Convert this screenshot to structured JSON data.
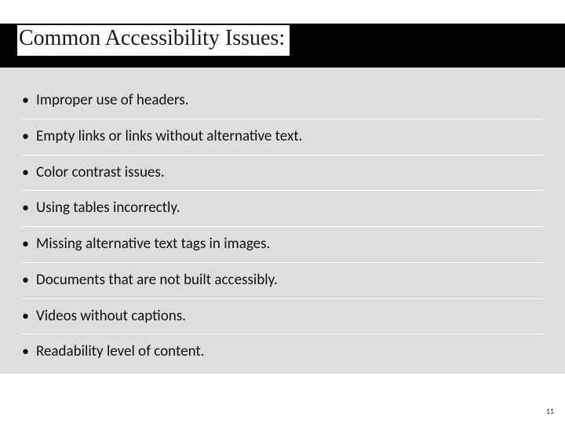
{
  "title": "Common Accessibility Issues:",
  "items": [
    "Improper use of headers.",
    "Empty links or links without alternative text.",
    "Color contrast issues.",
    "Using tables incorrectly.",
    "Missing alternative text tags in images.",
    "Documents that are not built accessibly.",
    "Videos without captions.",
    "Readability level of content."
  ],
  "page_number": "11"
}
